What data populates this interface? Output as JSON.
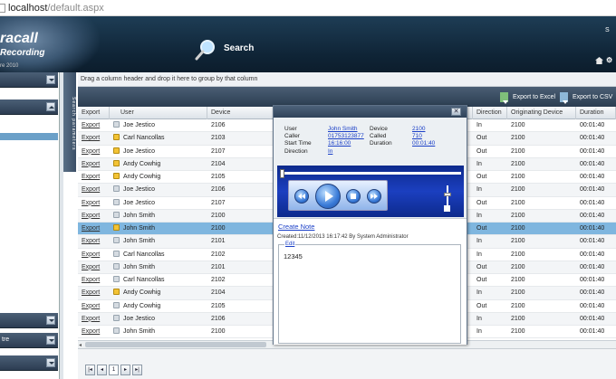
{
  "browser": {
    "url_host": "localhost",
    "url_path": "/default.aspx"
  },
  "banner": {
    "brand_line1": "racall",
    "brand_line2": "Recording",
    "brand_line3": "re 2010",
    "search_label": "Search",
    "corner_text": "S"
  },
  "side_tab_label": "Search parameters",
  "group_hint": "Drag a column header and drop it here to group by that column",
  "toolbar": {
    "export_excel": "Export to Excel",
    "export_csv": "Export to CSV"
  },
  "columns": [
    {
      "label": "Export"
    },
    {
      "label": "User"
    },
    {
      "label": "Device"
    },
    {
      "label": ""
    },
    {
      "label": "Direction"
    },
    {
      "label": "Originating Device"
    },
    {
      "label": "Duration"
    }
  ],
  "rows": [
    {
      "export": "Export",
      "user_icon": "phone-icon",
      "user": "Joe Jestico",
      "device": "2106",
      "direction": "In",
      "orig": "2100",
      "duration": "00:01:40"
    },
    {
      "export": "Export",
      "user_icon": "star-icon",
      "user": "Carl Nancollas",
      "device": "2103",
      "direction": "Out",
      "orig": "2100",
      "duration": "00:01:40"
    },
    {
      "export": "Export",
      "user_icon": "star-icon",
      "user": "Joe Jestico",
      "device": "2107",
      "direction": "Out",
      "orig": "2100",
      "duration": "00:01:40"
    },
    {
      "export": "Export",
      "user_icon": "star-icon",
      "user": "Andy Cowhig",
      "device": "2104",
      "direction": "In",
      "orig": "2100",
      "duration": "00:01:40"
    },
    {
      "export": "Export",
      "user_icon": "star-icon",
      "user": "Andy Cowhig",
      "device": "2105",
      "direction": "Out",
      "orig": "2100",
      "duration": "00:01:40"
    },
    {
      "export": "Export",
      "user_icon": "phone-icon",
      "user": "Joe Jestico",
      "device": "2106",
      "direction": "In",
      "orig": "2100",
      "duration": "00:01:40"
    },
    {
      "export": "Export",
      "user_icon": "phone-icon",
      "user": "Joe Jestico",
      "device": "2107",
      "direction": "Out",
      "orig": "2100",
      "duration": "00:01:40"
    },
    {
      "export": "Export",
      "user_icon": "phone-icon",
      "user": "John Smith",
      "device": "2100",
      "direction": "In",
      "orig": "2100",
      "duration": "00:01:40"
    },
    {
      "export": "Export",
      "user_icon": "star-icon",
      "user": "John Smith",
      "device": "2100",
      "direction": "Out",
      "orig": "2100",
      "duration": "00:01:40"
    },
    {
      "export": "Export",
      "user_icon": "phone-icon",
      "user": "John Smith",
      "device": "2101",
      "direction": "In",
      "orig": "2100",
      "duration": "00:01:40"
    },
    {
      "export": "Export",
      "user_icon": "phone-icon",
      "user": "Carl Nancollas",
      "device": "2102",
      "direction": "In",
      "orig": "2100",
      "duration": "00:01:40"
    },
    {
      "export": "Export",
      "user_icon": "phone-icon",
      "user": "John Smith",
      "device": "2101",
      "direction": "Out",
      "orig": "2100",
      "duration": "00:01:40"
    },
    {
      "export": "Export",
      "user_icon": "phone-icon",
      "user": "Carl Nancollas",
      "device": "2102",
      "direction": "Out",
      "orig": "2100",
      "duration": "00:01:40"
    },
    {
      "export": "Export",
      "user_icon": "star-icon",
      "user": "Andy Cowhig",
      "device": "2104",
      "direction": "In",
      "orig": "2100",
      "duration": "00:01:40"
    },
    {
      "export": "Export",
      "user_icon": "phone-icon",
      "user": "Andy Cowhig",
      "device": "2105",
      "direction": "Out",
      "orig": "2100",
      "duration": "00:01:40"
    },
    {
      "export": "Export",
      "user_icon": "phone-icon",
      "user": "Joe Jestico",
      "device": "2106",
      "direction": "In",
      "orig": "2100",
      "duration": "00:01:40"
    },
    {
      "export": "Export",
      "user_icon": "phone-icon",
      "user": "John Smith",
      "device": "2100",
      "direction": "In",
      "orig": "2100",
      "duration": "00:01:40"
    }
  ],
  "pager": {
    "current_page": "1"
  },
  "nav": {
    "footer_label": "tre"
  },
  "dialog": {
    "close_label": "✕",
    "info": {
      "user_label": "User",
      "user_value": "John Smith",
      "device_label": "Device",
      "device_value": "2100",
      "caller_label": "Caller",
      "caller_value": "01753123877",
      "called_label": "Called",
      "called_value": "710",
      "start_label": "Start Time",
      "start_value": "16:16:00",
      "duration_label": "Duration",
      "duration_value": "00:01:40",
      "direction_label": "Direction",
      "direction_value": "In"
    },
    "create_note": "Create Note",
    "created_text": "Created:11/12/2013 16:17:42 By System Administrator",
    "edit_label": "Edit",
    "note_text": "12345"
  },
  "colors": {
    "banner": "#1e3d55",
    "selected_row": "#7fb6df",
    "player": "#1b3fc0",
    "link": "#1a3fc7"
  }
}
